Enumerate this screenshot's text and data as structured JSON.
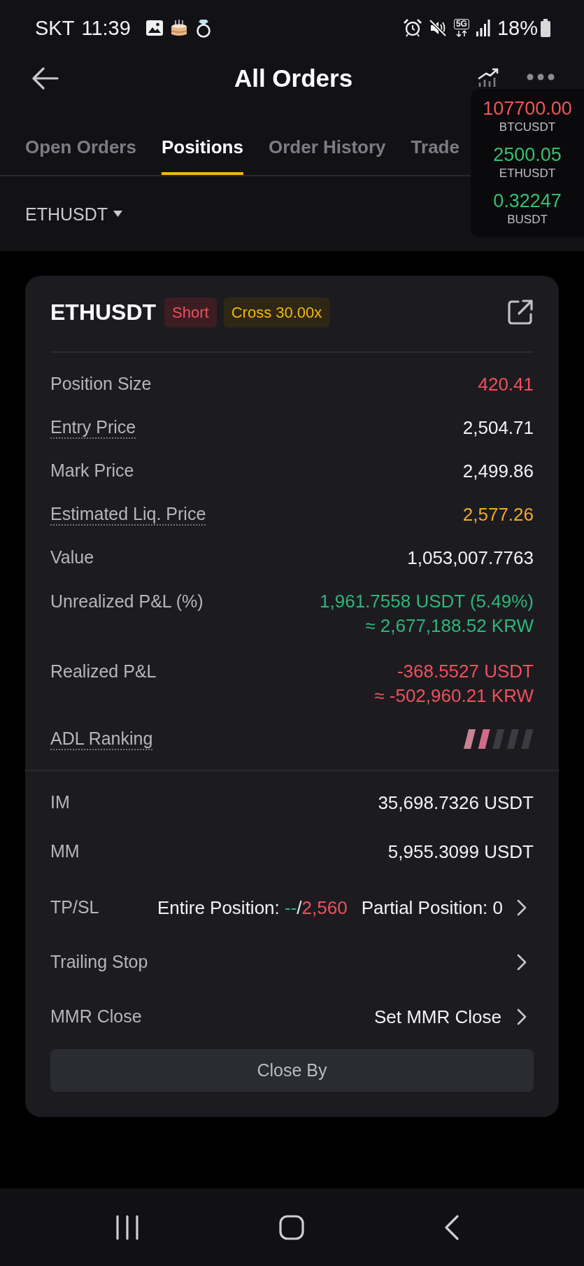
{
  "status_bar": {
    "carrier": "SKT",
    "time": "11:39",
    "network": "5G",
    "battery": "18%"
  },
  "header": {
    "title": "All Orders"
  },
  "tabs": [
    {
      "label": "Open Orders",
      "selected": false
    },
    {
      "label": "Positions",
      "selected": true
    },
    {
      "label": "Order History",
      "selected": false
    },
    {
      "label": "Trade",
      "selected": false
    }
  ],
  "filter": {
    "symbol": "ETHUSDT"
  },
  "ticker_overlay": [
    {
      "price": "107700.00",
      "symbol": "BTCUSDT",
      "color": "#ef5458"
    },
    {
      "price": "2500.05",
      "symbol": "ETHUSDT",
      "color": "#35c06f"
    },
    {
      "price": "0.32247",
      "symbol": "BUSDT",
      "color": "#35c06f"
    }
  ],
  "position": {
    "symbol": "ETHUSDT",
    "badges": [
      {
        "label": "Short",
        "kind": "side"
      },
      {
        "label": "Cross 30.00x",
        "kind": "margin"
      }
    ],
    "details": [
      {
        "kind": "value",
        "label": "Position Size",
        "dotted": false,
        "values": [
          "420.41"
        ],
        "color": "#f0505c"
      },
      {
        "kind": "value",
        "label": "Entry Price",
        "dotted": true,
        "values": [
          "2,504.71"
        ],
        "color": "#f2f2f2"
      },
      {
        "kind": "value",
        "label": "Mark Price",
        "dotted": false,
        "values": [
          "2,499.86"
        ],
        "color": "#f2f2f2"
      },
      {
        "kind": "value",
        "label": "Estimated Liq. Price",
        "dotted": true,
        "values": [
          "2,577.26"
        ],
        "color": "#f0a92d"
      },
      {
        "kind": "value",
        "label": "Value",
        "dotted": false,
        "values": [
          "1,053,007.7763"
        ],
        "color": "#f2f2f2"
      },
      {
        "kind": "value",
        "label": "Unrealized P&L (%)",
        "dotted": false,
        "values": [
          "1,961.7558 USDT (5.49%)",
          "≈ 2,677,188.52 KRW"
        ],
        "color": "#2fb57b"
      },
      {
        "kind": "value",
        "label": "Realized P&L",
        "dotted": false,
        "values": [
          "-368.5527 USDT",
          "≈ -502,960.21 KRW"
        ],
        "color": "#f0505c"
      },
      {
        "kind": "meter",
        "label": "ADL Ranking",
        "dotted": true,
        "level": 0.4
      }
    ],
    "margins": [
      {
        "label": "IM",
        "value": "35,698.7326 USDT"
      },
      {
        "label": "MM",
        "value": "5,955.3099 USDT"
      }
    ],
    "actions": [
      {
        "kind": "tpsl",
        "label": "TP/SL",
        "entire_label": "Entire Position:",
        "take_profit": "--",
        "separator": "/",
        "stop_loss": "2,560",
        "partial": "Partial Position: 0"
      },
      {
        "kind": "link",
        "label": "Trailing Stop"
      },
      {
        "kind": "link",
        "label": "MMR Close",
        "value": "Set MMR Close"
      }
    ],
    "button": "Close By"
  }
}
